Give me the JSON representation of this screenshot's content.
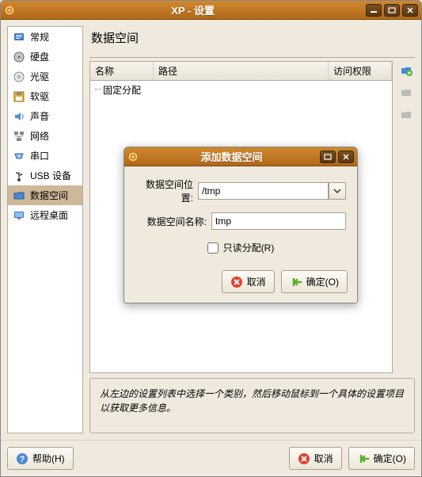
{
  "window": {
    "title": "XP - 设置"
  },
  "sidebar": {
    "items": [
      {
        "label": "常规"
      },
      {
        "label": "硬盘"
      },
      {
        "label": "光驱"
      },
      {
        "label": "软驱"
      },
      {
        "label": "声音"
      },
      {
        "label": "网络"
      },
      {
        "label": "串口"
      },
      {
        "label": "USB 设备"
      },
      {
        "label": "数据空间"
      },
      {
        "label": "远程桌面"
      }
    ]
  },
  "main": {
    "title": "数据空间",
    "columns": {
      "name": "名称",
      "path": "路径",
      "access": "访问权限"
    },
    "rows": [
      {
        "name": "固定分配"
      }
    ],
    "hint": "从左边的设置列表中选择一个类别，然后移动鼠标到一个具体的设置项目以获取更多信息。"
  },
  "dialog": {
    "title": "添加数据空间",
    "path_label": "数据空间位置:",
    "path_value": "/tmp",
    "name_label": "数据空间名称:",
    "name_value": "tmp",
    "readonly_label": "只读分配(R)",
    "cancel": "取消",
    "ok": "确定(O)"
  },
  "footer": {
    "help": "帮助(H)",
    "cancel": "取消",
    "ok": "确定(O)"
  }
}
